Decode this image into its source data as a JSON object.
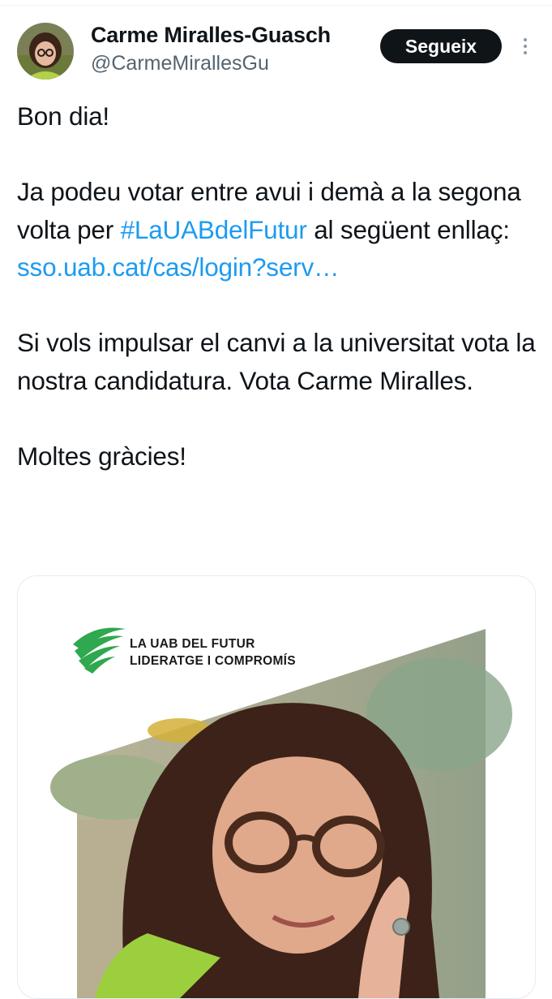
{
  "author": {
    "name": "Carme Miralles-Guasch",
    "handle": "@CarmeMirallesGu",
    "avatar_icon": "profile-photo"
  },
  "follow_button": {
    "label": "Segueix"
  },
  "more_icon": "more-vertical-icon",
  "tweet": {
    "greeting": "Bon dia!",
    "para2_a": "Ja podeu votar entre avui i demà a la segona volta per ",
    "hashtag": "#LaUABdelFutur",
    "para2_b": " al següent enllaç: ",
    "link": "sso.uab.cat/cas/login?serv…",
    "para3": "Si vols impulsar el canvi a la universitat vota la nostra candidatura. Vota Carme Miralles.",
    "closing": "Moltes gràcies!"
  },
  "card": {
    "logo_line1": "LA UAB DEL FUTUR",
    "logo_line2": "LIDERATGE I COMPROMÍS"
  },
  "colors": {
    "link": "#1d9bf0",
    "text": "#0f1419",
    "secondary": "#536471",
    "logo_green": "#2fa84f",
    "background": "#ffffff"
  }
}
